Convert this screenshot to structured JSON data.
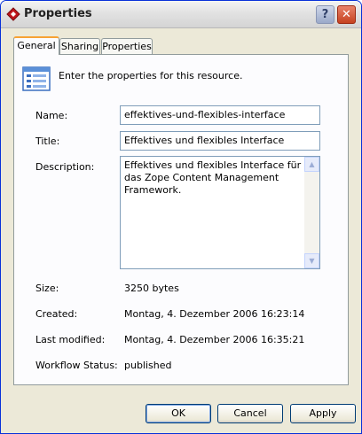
{
  "window": {
    "title": "Properties"
  },
  "titlebar": {
    "help_label": "?",
    "close_label": "✕"
  },
  "tabs": [
    {
      "label": "General",
      "active": true
    },
    {
      "label": "Sharing",
      "active": false
    },
    {
      "label": "Properties",
      "active": false
    }
  ],
  "general": {
    "intro": "Enter the properties for this resource.",
    "name_label": "Name:",
    "name_value": "effektives-und-flexibles-interface",
    "title_label": "Title:",
    "title_value": "Effektives und flexibles Interface",
    "description_label": "Description:",
    "description_value": "Effektives und flexibles Interface für das Zope Content Management Framework.",
    "size_label": "Size:",
    "size_value": "3250 bytes",
    "created_label": "Created:",
    "created_value": "Montag, 4. Dezember 2006 16:23:14",
    "modified_label": "Last modified:",
    "modified_value": "Montag, 4. Dezember 2006 16:35:21",
    "workflow_label": "Workflow Status:",
    "workflow_value": "published"
  },
  "buttons": {
    "ok": "OK",
    "cancel": "Cancel",
    "apply": "Apply"
  },
  "colors": {
    "window_border": "#0831d9",
    "tab_accent": "#f7a234",
    "close_red": "#c6421f"
  },
  "icons": {
    "app": "red-diamond-icon",
    "resource": "properties-sheet-icon"
  }
}
